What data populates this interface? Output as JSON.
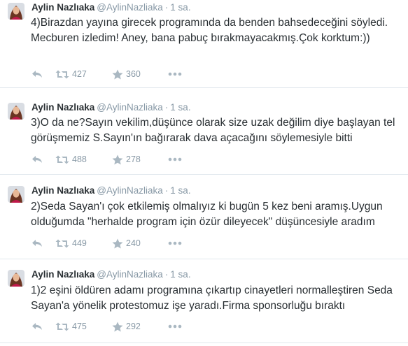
{
  "tweets": [
    {
      "name": "Aylin Nazlıaka",
      "handle": "@AylinNazliaka",
      "separator": "·",
      "time": "1 sa.",
      "text": "4)Birazdan yayına girecek programında da benden bahsedeceğini söyledi. Mecburen izledim! Aney, bana pabuç bırakmayacakmış.Çok korktum:))",
      "retweets": "427",
      "favorites": "360"
    },
    {
      "name": "Aylin Nazlıaka",
      "handle": "@AylinNazliaka",
      "separator": "·",
      "time": "1 sa.",
      "text": "3)O da ne?Sayın vekilim,düşünce olarak size uzak değilim diye başlayan tel görüşmemiz S.Sayın'ın bağırarak dava açacağını söylemesiyle bitti",
      "retweets": "488",
      "favorites": "278"
    },
    {
      "name": "Aylin Nazlıaka",
      "handle": "@AylinNazliaka",
      "separator": "·",
      "time": "1 sa.",
      "text": "2)Seda Sayan'ı çok etkilemiş olmalıyız ki bugün 5 kez beni aramış.Uygun olduğumda \"herhalde program için özür dileyecek\" düşüncesiyle aradım",
      "retweets": "449",
      "favorites": "240"
    },
    {
      "name": "Aylin Nazlıaka",
      "handle": "@AylinNazliaka",
      "separator": "·",
      "time": "1 sa.",
      "text": "1)2 eşini öldüren adamı programına çıkartıp cinayetleri normalleştiren Seda Sayan'a yönelik protestomuz işe yaradı.Firma sponsorluğu bıraktı",
      "retweets": "475",
      "favorites": "292"
    }
  ],
  "icons": {
    "reply": "reply-icon",
    "retweet": "retweet-icon",
    "favorite": "star-icon",
    "more": "more-icon"
  },
  "colors": {
    "name": "#292f33",
    "meta": "#8899a6",
    "icon": "#aab8c2",
    "divider": "#e1e8ed"
  }
}
